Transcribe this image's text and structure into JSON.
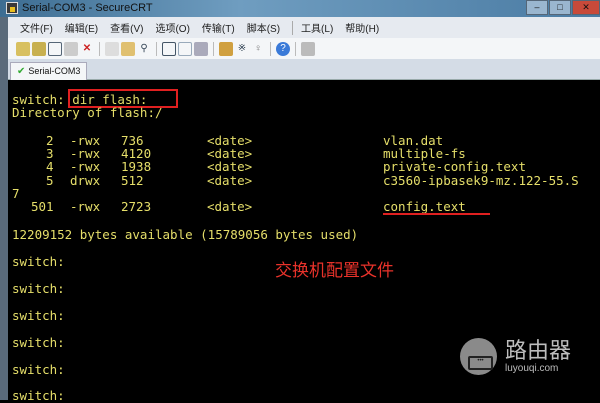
{
  "window": {
    "title": "Serial-COM3 - SecureCRT",
    "min": "–",
    "max": "□",
    "close": "✕"
  },
  "menu": [
    "文件(F)",
    "编辑(E)",
    "查看(V)",
    "选项(O)",
    "传输(T)",
    "脚本(S)",
    "工具(L)",
    "帮助(H)"
  ],
  "toolbar": {
    "icons": [
      "quick-connect",
      "connect-in-tab",
      "reconnect",
      "disconnect-all",
      "disconnect",
      "copy",
      "paste",
      "find",
      "print-setup",
      "print-selection",
      "print",
      "session-options",
      "keymap",
      "key",
      "help",
      "lock"
    ]
  },
  "tab": {
    "label": "Serial-COM3"
  },
  "terminal": {
    "prompt_cmd": "switch: dir flash:",
    "directory": "Directory of flash:/",
    "rows": [
      {
        "num": "2",
        "perm": "-rwx",
        "size": "736",
        "date": "<date>",
        "name": "vlan.dat"
      },
      {
        "num": "3",
        "perm": "-rwx",
        "size": "4120",
        "date": "<date>",
        "name": "multiple-fs"
      },
      {
        "num": "4",
        "perm": "-rwx",
        "size": "1938",
        "date": "<date>",
        "name": "private-config.text"
      },
      {
        "num": "5",
        "perm": "drwx",
        "size": "512",
        "date": "<date>",
        "name": "c3560-ipbasek9-mz.122-55.S"
      }
    ],
    "wrap": "7",
    "row501": {
      "num": "501",
      "perm": "-rwx",
      "size": "2723",
      "date": "<date>",
      "name": "config.text"
    },
    "bytes": "12209152 bytes available (15789056 bytes used)",
    "prompts": [
      "switch:",
      "switch:",
      "switch:",
      "switch:",
      "switch:",
      "switch:"
    ]
  },
  "annotation": "交换机配置文件",
  "watermark": {
    "title": "路由器",
    "url": "luyouqi.com"
  }
}
